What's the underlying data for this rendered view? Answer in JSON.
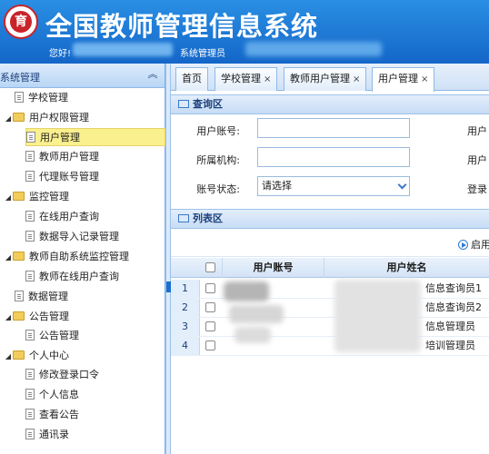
{
  "app": {
    "title": "全国教师管理信息系统",
    "greeting": "您好!",
    "role": "系统管理员",
    "logo_glyph": "育"
  },
  "sidebar": {
    "header": "系统管理",
    "collapse_glyph": "︽",
    "items": [
      {
        "label": "学校管理",
        "type": "leaf"
      },
      {
        "label": "用户权限管理",
        "type": "folder"
      },
      {
        "label": "用户管理",
        "type": "leaf",
        "selected": true
      },
      {
        "label": "教师用户管理",
        "type": "leaf"
      },
      {
        "label": "代理账号管理",
        "type": "leaf"
      },
      {
        "label": "监控管理",
        "type": "folder"
      },
      {
        "label": "在线用户查询",
        "type": "leaf"
      },
      {
        "label": "数据导入记录管理",
        "type": "leaf"
      },
      {
        "label": "教师自助系统监控管理",
        "type": "folder"
      },
      {
        "label": "教师在线用户查询",
        "type": "leaf"
      },
      {
        "label": "数据管理",
        "type": "leaf"
      },
      {
        "label": "公告管理",
        "type": "folder"
      },
      {
        "label": "公告管理",
        "type": "leaf"
      },
      {
        "label": "个人中心",
        "type": "folder"
      },
      {
        "label": "修改登录口令",
        "type": "leaf"
      },
      {
        "label": "个人信息",
        "type": "leaf"
      },
      {
        "label": "查看公告",
        "type": "leaf"
      },
      {
        "label": "通讯录",
        "type": "leaf"
      }
    ]
  },
  "tabs": [
    {
      "label": "首页"
    },
    {
      "label": "学校管理",
      "close": "×"
    },
    {
      "label": "教师用户管理",
      "close": "×"
    },
    {
      "label": "用户管理",
      "close": "×",
      "active": true
    }
  ],
  "query": {
    "header": "查询区",
    "user_account_label": "用户账号:",
    "org_label": "所属机构:",
    "status_label": "账号状态:",
    "status_value": "请选择",
    "right_col_1": "用户",
    "right_col_2": "用户",
    "right_col_3": "登录"
  },
  "list": {
    "header": "列表区",
    "start_label": "启用",
    "columns": [
      "用户账号",
      "用户姓名"
    ],
    "rows": [
      {
        "num": "1",
        "name": "信息查询员1"
      },
      {
        "num": "2",
        "name": "信息查询员2"
      },
      {
        "num": "3",
        "name": "信息管理员"
      },
      {
        "num": "4",
        "name": "培训管理员"
      }
    ]
  },
  "colors": {
    "header_blue": "#1466c8",
    "selected_bg": "#fbf08e",
    "panel_blue": "#c7dcf5"
  }
}
